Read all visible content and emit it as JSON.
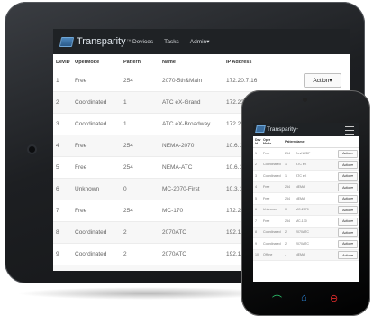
{
  "tablet": {
    "brand": "Transparity",
    "brand_mark": "™",
    "nav": [
      "Devices",
      "Tasks",
      "Admin"
    ],
    "columns": [
      "DevID",
      "OperMode",
      "Pattern",
      "Name",
      "IP Address"
    ],
    "action_label": "Action▾",
    "rows": [
      {
        "id": "1",
        "mode": "Free",
        "pattern": "254",
        "name": "2070-5th&Main",
        "ip": "172.20.7.16",
        "action": "Action▾"
      },
      {
        "id": "2",
        "mode": "Coordinated",
        "pattern": "1",
        "name": "ATC eX-Grand",
        "ip": "172.20.7.2",
        "action": ""
      },
      {
        "id": "3",
        "mode": "Coordinated",
        "pattern": "1",
        "name": "ATC eX-Broadway",
        "ip": "172.20.7.",
        "action": ""
      },
      {
        "id": "4",
        "mode": "Free",
        "pattern": "254",
        "name": "NEMA-2070",
        "ip": "10.6.1.10",
        "action": ""
      },
      {
        "id": "5",
        "mode": "Free",
        "pattern": "254",
        "name": "NEMA-ATC",
        "ip": "10.6.1.10",
        "action": ""
      },
      {
        "id": "6",
        "mode": "Unknown",
        "pattern": "0",
        "name": "MC-2070-First",
        "ip": "10.3.1.10",
        "action": ""
      },
      {
        "id": "7",
        "mode": "Free",
        "pattern": "254",
        "name": "MC-170",
        "ip": "172.20.7.",
        "action": ""
      },
      {
        "id": "8",
        "mode": "Coordinated",
        "pattern": "2",
        "name": "2070ATC",
        "ip": "192.168.1",
        "action": ""
      },
      {
        "id": "9",
        "mode": "Coordinated",
        "pattern": "2",
        "name": "2070ATC",
        "ip": "192.168.1",
        "action": ""
      },
      {
        "id": "10",
        "mode": "Offline",
        "pattern": "-",
        "name": "NEMA",
        "ip": "192.168.1",
        "action": ""
      }
    ]
  },
  "phone": {
    "brand": "Transparity",
    "brand_mark": "™",
    "columns": [
      "Dev Id",
      "Oper Mode",
      "Pattern",
      "Name"
    ],
    "rows": [
      {
        "id": "1",
        "mode": "Free",
        "pattern": "254",
        "name": "DevNUDF",
        "action": "Action▾"
      },
      {
        "id": "2",
        "mode": "Coordinated",
        "pattern": "1",
        "name": "ATC eX",
        "action": "Action▾"
      },
      {
        "id": "3",
        "mode": "Coordinated",
        "pattern": "1",
        "name": "ATC eX",
        "action": "Action▾"
      },
      {
        "id": "4",
        "mode": "Free",
        "pattern": "254",
        "name": "NEMA",
        "action": "Action▾"
      },
      {
        "id": "5",
        "mode": "Free",
        "pattern": "254",
        "name": "NEMA",
        "action": "Action▾"
      },
      {
        "id": "6",
        "mode": "Unknown",
        "pattern": "0",
        "name": "MC-2070",
        "action": "Action▾"
      },
      {
        "id": "7",
        "mode": "Free",
        "pattern": "254",
        "name": "MC-170",
        "action": "Action▾"
      },
      {
        "id": "8",
        "mode": "Coordinated",
        "pattern": "2",
        "name": "2070ATC",
        "action": "Action▾"
      },
      {
        "id": "9",
        "mode": "Coordinated",
        "pattern": "2",
        "name": "2070ATC",
        "action": "Action▾"
      },
      {
        "id": "10",
        "mode": "Offline",
        "pattern": "-",
        "name": "NEMA",
        "action": "Action▾"
      }
    ],
    "icons": [
      "back-icon",
      "home-icon",
      "recents-icon"
    ]
  },
  "colors": {
    "navbar": "#1f2225",
    "phone_back": "#2ecc71",
    "phone_home": "#2f8de4",
    "phone_recent": "#e02b2b"
  }
}
